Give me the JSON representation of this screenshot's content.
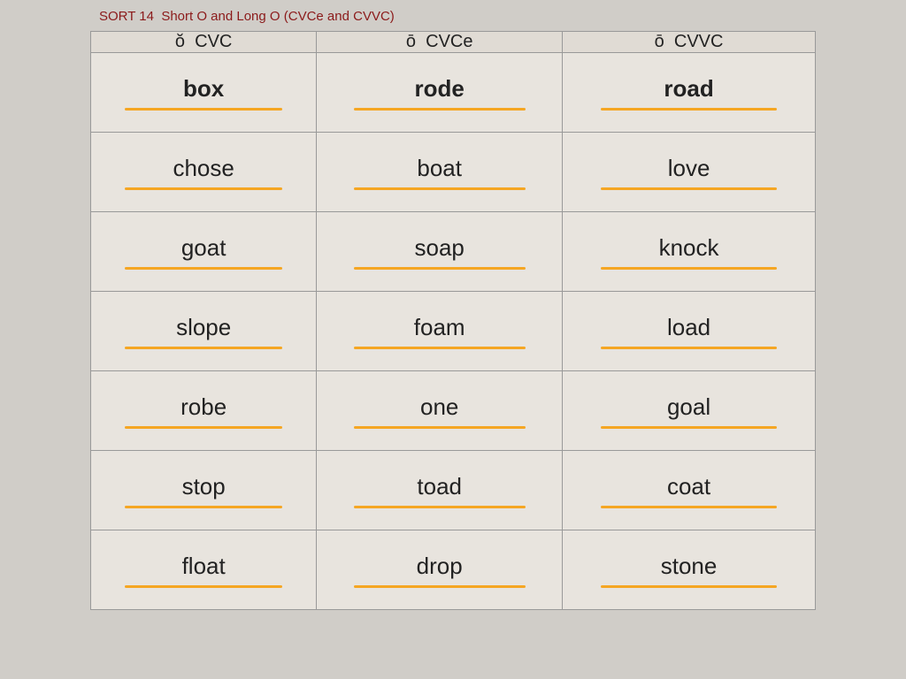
{
  "title": {
    "sort_num": "SORT 14",
    "description": "Short O and Long O (CVCe and CVVC)"
  },
  "headers": [
    {
      "id": "col1",
      "diacritic": "ŏ",
      "pattern": "CVC"
    },
    {
      "id": "col2",
      "diacritic": "ō",
      "pattern": "CVCe"
    },
    {
      "id": "col3",
      "diacritic": "ō",
      "pattern": "CVVC"
    }
  ],
  "rows": [
    {
      "cells": [
        {
          "word": "box",
          "bold": true
        },
        {
          "word": "rode",
          "bold": true
        },
        {
          "word": "road",
          "bold": true
        }
      ]
    },
    {
      "cells": [
        {
          "word": "chose",
          "bold": false
        },
        {
          "word": "boat",
          "bold": false
        },
        {
          "word": "love",
          "bold": false
        }
      ]
    },
    {
      "cells": [
        {
          "word": "goat",
          "bold": false
        },
        {
          "word": "soap",
          "bold": false
        },
        {
          "word": "knock",
          "bold": false
        }
      ]
    },
    {
      "cells": [
        {
          "word": "slope",
          "bold": false
        },
        {
          "word": "foam",
          "bold": false
        },
        {
          "word": "load",
          "bold": false
        }
      ]
    },
    {
      "cells": [
        {
          "word": "robe",
          "bold": false
        },
        {
          "word": "one",
          "bold": false
        },
        {
          "word": "goal",
          "bold": false
        }
      ]
    },
    {
      "cells": [
        {
          "word": "stop",
          "bold": false
        },
        {
          "word": "toad",
          "bold": false
        },
        {
          "word": "coat",
          "bold": false
        }
      ]
    },
    {
      "cells": [
        {
          "word": "float",
          "bold": false
        },
        {
          "word": "drop",
          "bold": false
        },
        {
          "word": "stone",
          "bold": false
        }
      ]
    }
  ]
}
